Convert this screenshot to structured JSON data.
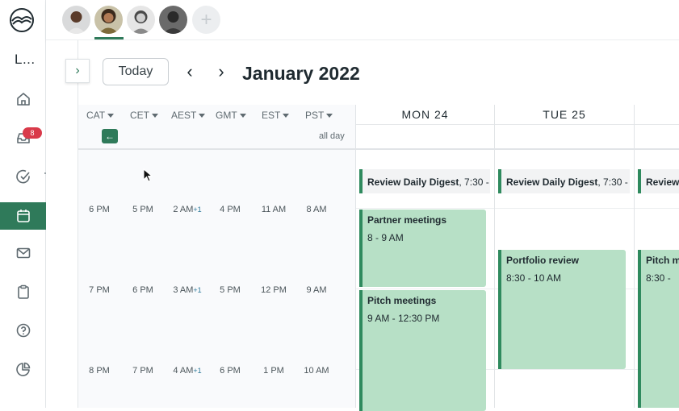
{
  "sidebar": {
    "user_initial": "L...",
    "inbox_badge": "8",
    "items": [
      {
        "name": "home",
        "icon": "home-icon"
      },
      {
        "name": "inbox",
        "icon": "inbox-icon"
      },
      {
        "name": "tasks",
        "icon": "check-circle-icon"
      },
      {
        "name": "calendar",
        "icon": "calendar-icon",
        "active": true
      },
      {
        "name": "mail",
        "icon": "mail-icon"
      },
      {
        "name": "clipboard",
        "icon": "clipboard-icon"
      },
      {
        "name": "help",
        "icon": "help-icon"
      },
      {
        "name": "reports",
        "icon": "pie-chart-icon"
      }
    ],
    "accent": "#2f7a5a"
  },
  "topbar": {
    "add_label": "+"
  },
  "toolbar": {
    "today_label": "Today",
    "prev_label": "‹",
    "next_label": "›",
    "month_title": "January 2022"
  },
  "timezones": {
    "headers": [
      "CAT",
      "CET",
      "AEST",
      "GMT",
      "EST",
      "PST"
    ],
    "allday_label": "all day",
    "rows": [
      [
        "6 PM",
        "5 PM",
        "2 AM",
        "4 PM",
        "11 AM",
        "8 AM"
      ],
      [
        "7 PM",
        "6 PM",
        "3 AM",
        "5 PM",
        "12 PM",
        "9 AM"
      ],
      [
        "8 PM",
        "7 PM",
        "4 AM",
        "6 PM",
        "1 PM",
        "10 AM"
      ]
    ],
    "plus_one": "+1"
  },
  "days": [
    {
      "label": "MON 24",
      "events": [
        {
          "title": "Review Daily Digest",
          "time": ", 7:30 -"
        },
        {
          "title": "Partner meetings",
          "time": "8 - 9 AM"
        },
        {
          "title": "Pitch meetings",
          "time": "9 AM - 12:30 PM"
        }
      ]
    },
    {
      "label": "TUE 25",
      "events": [
        {
          "title": "Review Daily Digest",
          "time": ", 7:30 -"
        },
        {
          "title": "Portfolio review",
          "time": "8:30 - 10 AM"
        }
      ]
    },
    {
      "label": "",
      "events": [
        {
          "title": "Review",
          "time": ""
        },
        {
          "title": "Pitch m",
          "time": "8:30 -"
        }
      ]
    }
  ]
}
